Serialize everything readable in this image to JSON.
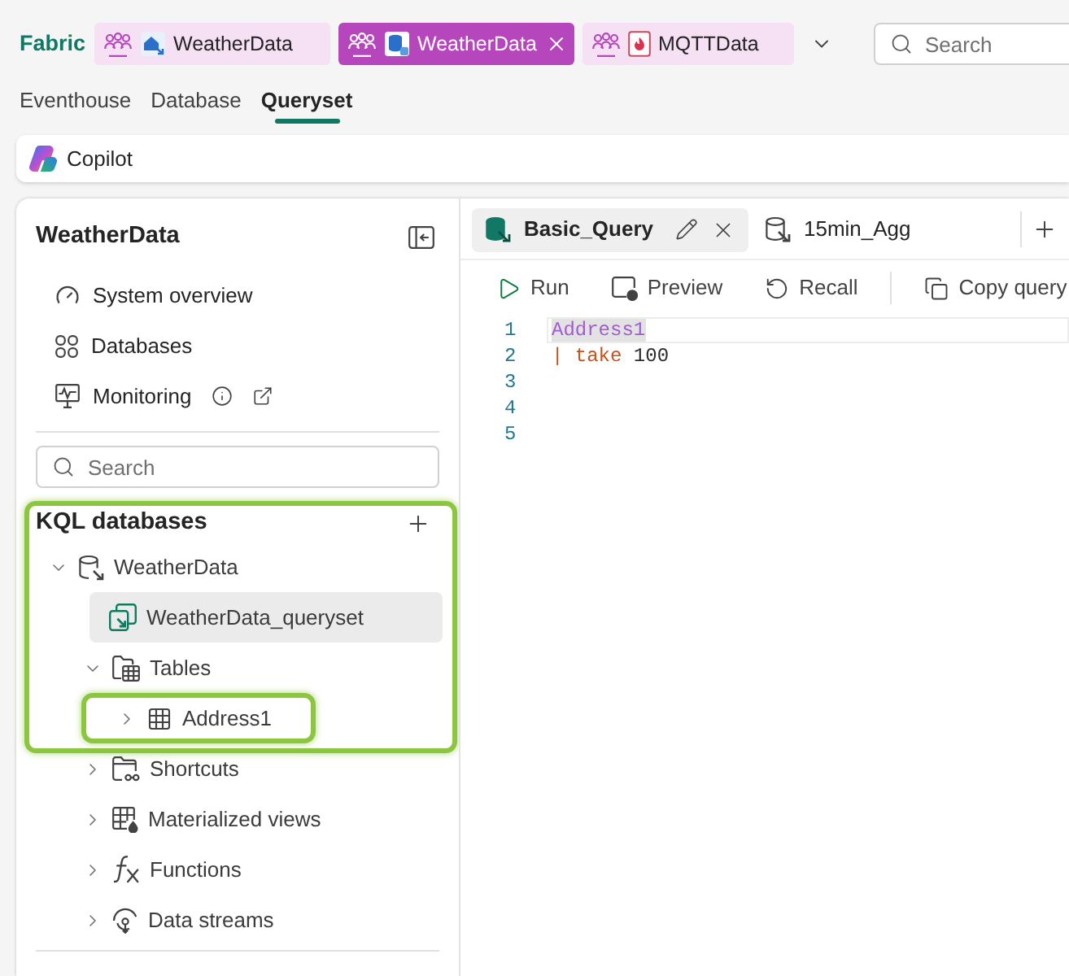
{
  "header": {
    "brand": "Fabric",
    "tabs": [
      {
        "label": "WeatherData",
        "kind": "eventhouse",
        "selected": false
      },
      {
        "label": "WeatherData",
        "kind": "database",
        "selected": true
      },
      {
        "label": "MQTTData",
        "kind": "eventstream",
        "selected": false
      }
    ],
    "search": {
      "placeholder": "Search"
    }
  },
  "nav_tabs": [
    {
      "label": "Eventhouse",
      "selected": false
    },
    {
      "label": "Database",
      "selected": false
    },
    {
      "label": "Queryset",
      "selected": true
    }
  ],
  "copilot": {
    "label": "Copilot"
  },
  "sidebar": {
    "title": "WeatherData",
    "nav": [
      {
        "label": "System overview",
        "kind": "overview"
      },
      {
        "label": "Databases",
        "kind": "databases"
      },
      {
        "label": "Monitoring",
        "kind": "monitoring"
      }
    ],
    "search": {
      "placeholder": "Search"
    },
    "kql_databases": {
      "title": "KQL databases",
      "highlighted": true,
      "tree": [
        {
          "label": "WeatherData",
          "kind": "database",
          "expanded": true,
          "selected": false,
          "highlighted": false,
          "children": [
            {
              "label": "WeatherData_queryset",
              "kind": "queryset",
              "selected": true,
              "highlighted": false
            },
            {
              "label": "Tables",
              "kind": "tables",
              "expanded": true,
              "selected": false,
              "highlighted": false,
              "children": [
                {
                  "label": "Address1",
                  "kind": "table",
                  "expanded": false,
                  "selected": false,
                  "highlighted": true
                }
              ]
            },
            {
              "label": "Shortcuts",
              "kind": "shortcuts",
              "expanded": false,
              "selected": false,
              "highlighted": false
            },
            {
              "label": "Materialized views",
              "kind": "views",
              "expanded": false,
              "selected": false,
              "highlighted": false
            },
            {
              "label": "Functions",
              "kind": "functions",
              "expanded": false,
              "selected": false,
              "highlighted": false
            },
            {
              "label": "Data streams",
              "kind": "streams",
              "expanded": false,
              "selected": false,
              "highlighted": false
            }
          ]
        }
      ]
    }
  },
  "editor": {
    "tabs": [
      {
        "label": "Basic_Query",
        "selected": true
      },
      {
        "label": "15min_Agg",
        "selected": false
      }
    ],
    "toolbar": [
      {
        "label": "Run",
        "kind": "run"
      },
      {
        "label": "Preview",
        "kind": "preview"
      },
      {
        "label": "Recall",
        "kind": "recall"
      },
      {
        "label": "Copy query",
        "kind": "copy"
      }
    ],
    "lines": [
      {
        "number": "1",
        "current": true,
        "tokens": [
          {
            "text": "Address1",
            "kind": "table",
            "highlighted": true
          }
        ]
      },
      {
        "number": "2",
        "current": false,
        "tokens": [
          {
            "text": "|",
            "kind": "operator",
            "highlighted": false
          },
          {
            "text": "take",
            "kind": "keyword",
            "highlighted": false
          },
          {
            "text": "100",
            "kind": "number",
            "highlighted": false
          }
        ]
      },
      {
        "number": "3",
        "current": false
      },
      {
        "number": "4",
        "current": false
      },
      {
        "number": "5",
        "current": false
      }
    ]
  }
}
